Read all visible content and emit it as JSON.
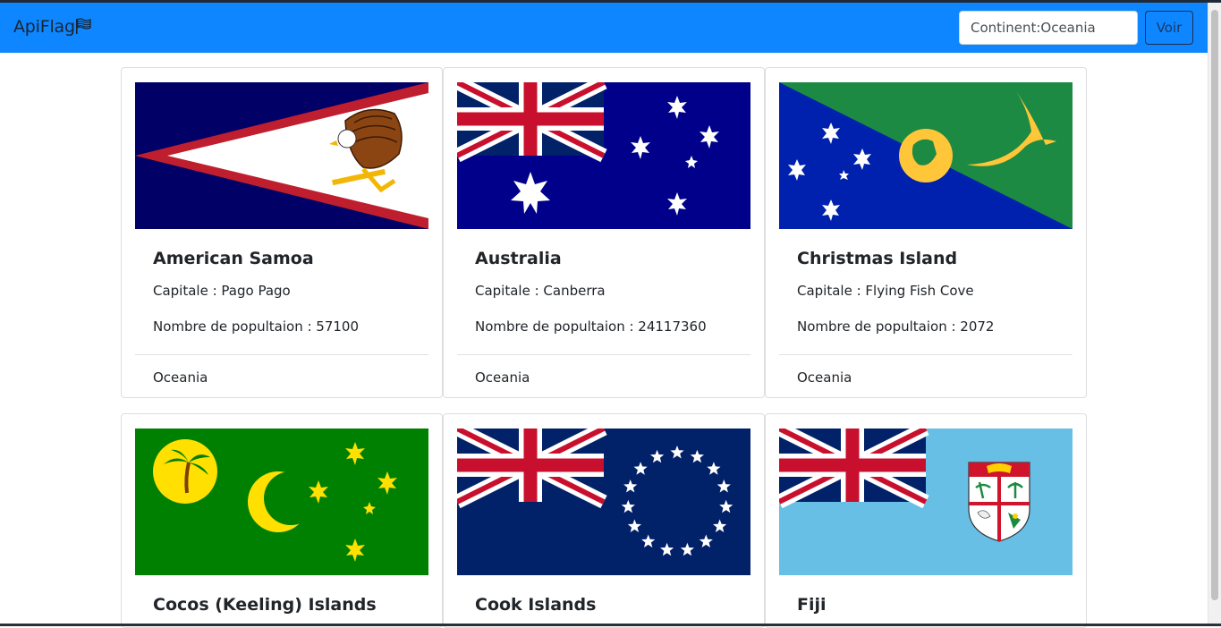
{
  "navbar": {
    "brand": "ApiFlag",
    "brand_icon": "flag-icon",
    "search_value": "Continent:Oceania",
    "button_label": "Voir",
    "color": "#0d86ff"
  },
  "cards": [
    {
      "name": "American Samoa",
      "capital": "Capitale : Pago Pago",
      "population": "Nombre de popultaion : 57100",
      "continent": "Oceania",
      "flag": "american-samoa-flag"
    },
    {
      "name": "Australia",
      "capital": "Capitale : Canberra",
      "population": "Nombre de popultaion : 24117360",
      "continent": "Oceania",
      "flag": "australia-flag"
    },
    {
      "name": "Christmas Island",
      "capital": "Capitale : Flying Fish Cove",
      "population": "Nombre de popultaion : 2072",
      "continent": "Oceania",
      "flag": "christmas-island-flag"
    },
    {
      "name": "Cocos (Keeling) Islands",
      "flag": "cocos-islands-flag"
    },
    {
      "name": "Cook Islands",
      "flag": "cook-islands-flag"
    },
    {
      "name": "Fiji",
      "flag": "fiji-flag"
    }
  ]
}
